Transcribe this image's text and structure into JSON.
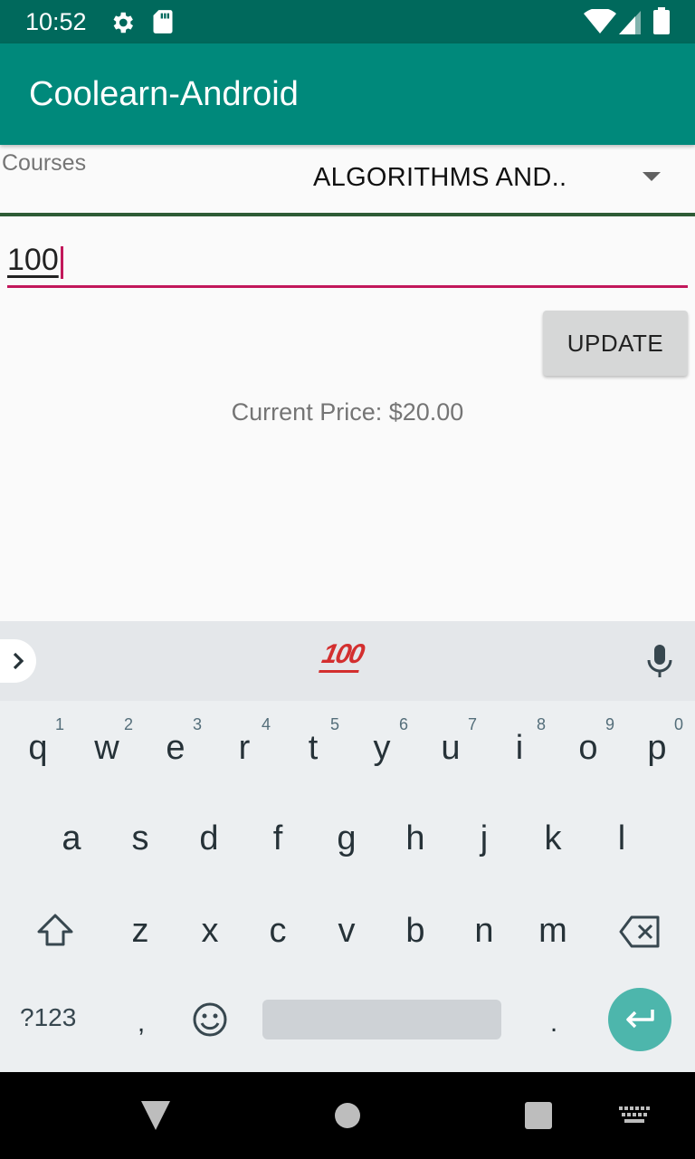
{
  "status_bar": {
    "time": "10:52"
  },
  "app_bar": {
    "title": "Coolearn-Android"
  },
  "form": {
    "courses_label": "Courses",
    "selected_course": "ALGORITHMS AND..",
    "price_input_value": "100",
    "update_button_label": "UPDATE",
    "current_price_text": "Current Price: $20.00"
  },
  "keyboard": {
    "suggestion_emoji": "100",
    "row1": [
      {
        "key": "q",
        "hint": "1"
      },
      {
        "key": "w",
        "hint": "2"
      },
      {
        "key": "e",
        "hint": "3"
      },
      {
        "key": "r",
        "hint": "4"
      },
      {
        "key": "t",
        "hint": "5"
      },
      {
        "key": "y",
        "hint": "6"
      },
      {
        "key": "u",
        "hint": "7"
      },
      {
        "key": "i",
        "hint": "8"
      },
      {
        "key": "o",
        "hint": "9"
      },
      {
        "key": "p",
        "hint": "0"
      }
    ],
    "row2": [
      "a",
      "s",
      "d",
      "f",
      "g",
      "h",
      "j",
      "k",
      "l"
    ],
    "row3": [
      "z",
      "x",
      "c",
      "v",
      "b",
      "n",
      "m"
    ],
    "symbols_key": "?123",
    "comma_key": ",",
    "period_key": "."
  },
  "colors": {
    "status_bar": "#00695c",
    "app_bar": "#00897b",
    "accent": "#c2185b",
    "enter_key": "#4db6ac"
  }
}
